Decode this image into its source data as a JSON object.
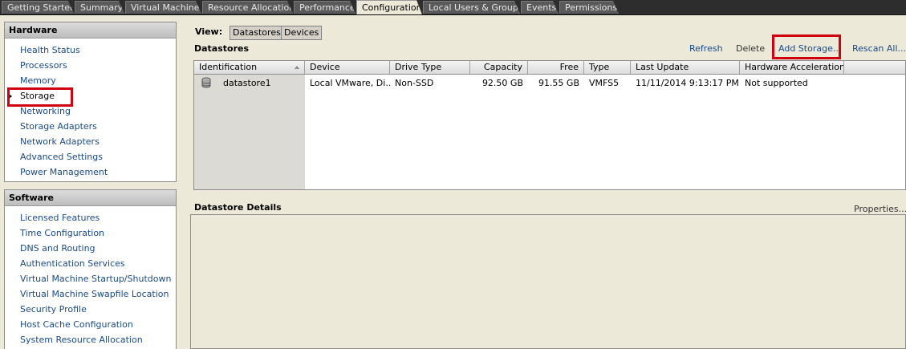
{
  "tabs": [
    {
      "label": "Getting Started",
      "active": false
    },
    {
      "label": "Summary",
      "active": false
    },
    {
      "label": "Virtual Machines",
      "active": false
    },
    {
      "label": "Resource Allocation",
      "active": false
    },
    {
      "label": "Performance",
      "active": false
    },
    {
      "label": "Configuration",
      "active": true
    },
    {
      "label": "Local Users & Groups",
      "active": false
    },
    {
      "label": "Events",
      "active": false
    },
    {
      "label": "Permissions",
      "active": false
    }
  ],
  "hardware": {
    "title": "Hardware",
    "items": [
      {
        "label": "Health Status"
      },
      {
        "label": "Processors"
      },
      {
        "label": "Memory"
      },
      {
        "label": "Storage",
        "selected": true
      },
      {
        "label": "Networking"
      },
      {
        "label": "Storage Adapters"
      },
      {
        "label": "Network Adapters"
      },
      {
        "label": "Advanced Settings"
      },
      {
        "label": "Power Management"
      }
    ]
  },
  "software": {
    "title": "Software",
    "items": [
      {
        "label": "Licensed Features"
      },
      {
        "label": "Time Configuration"
      },
      {
        "label": "DNS and Routing"
      },
      {
        "label": "Authentication Services"
      },
      {
        "label": "Virtual Machine Startup/Shutdown"
      },
      {
        "label": "Virtual Machine Swapfile Location"
      },
      {
        "label": "Security Profile"
      },
      {
        "label": "Host Cache Configuration"
      },
      {
        "label": "System Resource Allocation"
      }
    ]
  },
  "view": {
    "label": "View:",
    "options": [
      "Datastores",
      "Devices"
    ],
    "selected": "Datastores"
  },
  "datastores": {
    "title": "Datastores",
    "actions": {
      "refresh": "Refresh",
      "delete": "Delete",
      "add_storage": "Add Storage...",
      "rescan_all": "Rescan All..."
    },
    "columns": [
      "Identification",
      "Device",
      "Drive Type",
      "Capacity",
      "Free",
      "Type",
      "Last Update",
      "Hardware Acceleration"
    ],
    "rows": [
      {
        "identification": "datastore1",
        "device": "Local VMware, Di...",
        "drive_type": "Non-SSD",
        "capacity": "92.50 GB",
        "free": "91.55 GB",
        "type": "VMFS5",
        "last_update": "11/11/2014 9:13:17 PM",
        "hardware_acceleration": "Not supported"
      }
    ]
  },
  "details": {
    "title": "Datastore Details",
    "properties": "Properties..."
  },
  "colors": {
    "link": "#1a4a8c",
    "highlight_box": "#d00010",
    "tabbar": "#2d2d2d",
    "background": "#ece9d8"
  }
}
